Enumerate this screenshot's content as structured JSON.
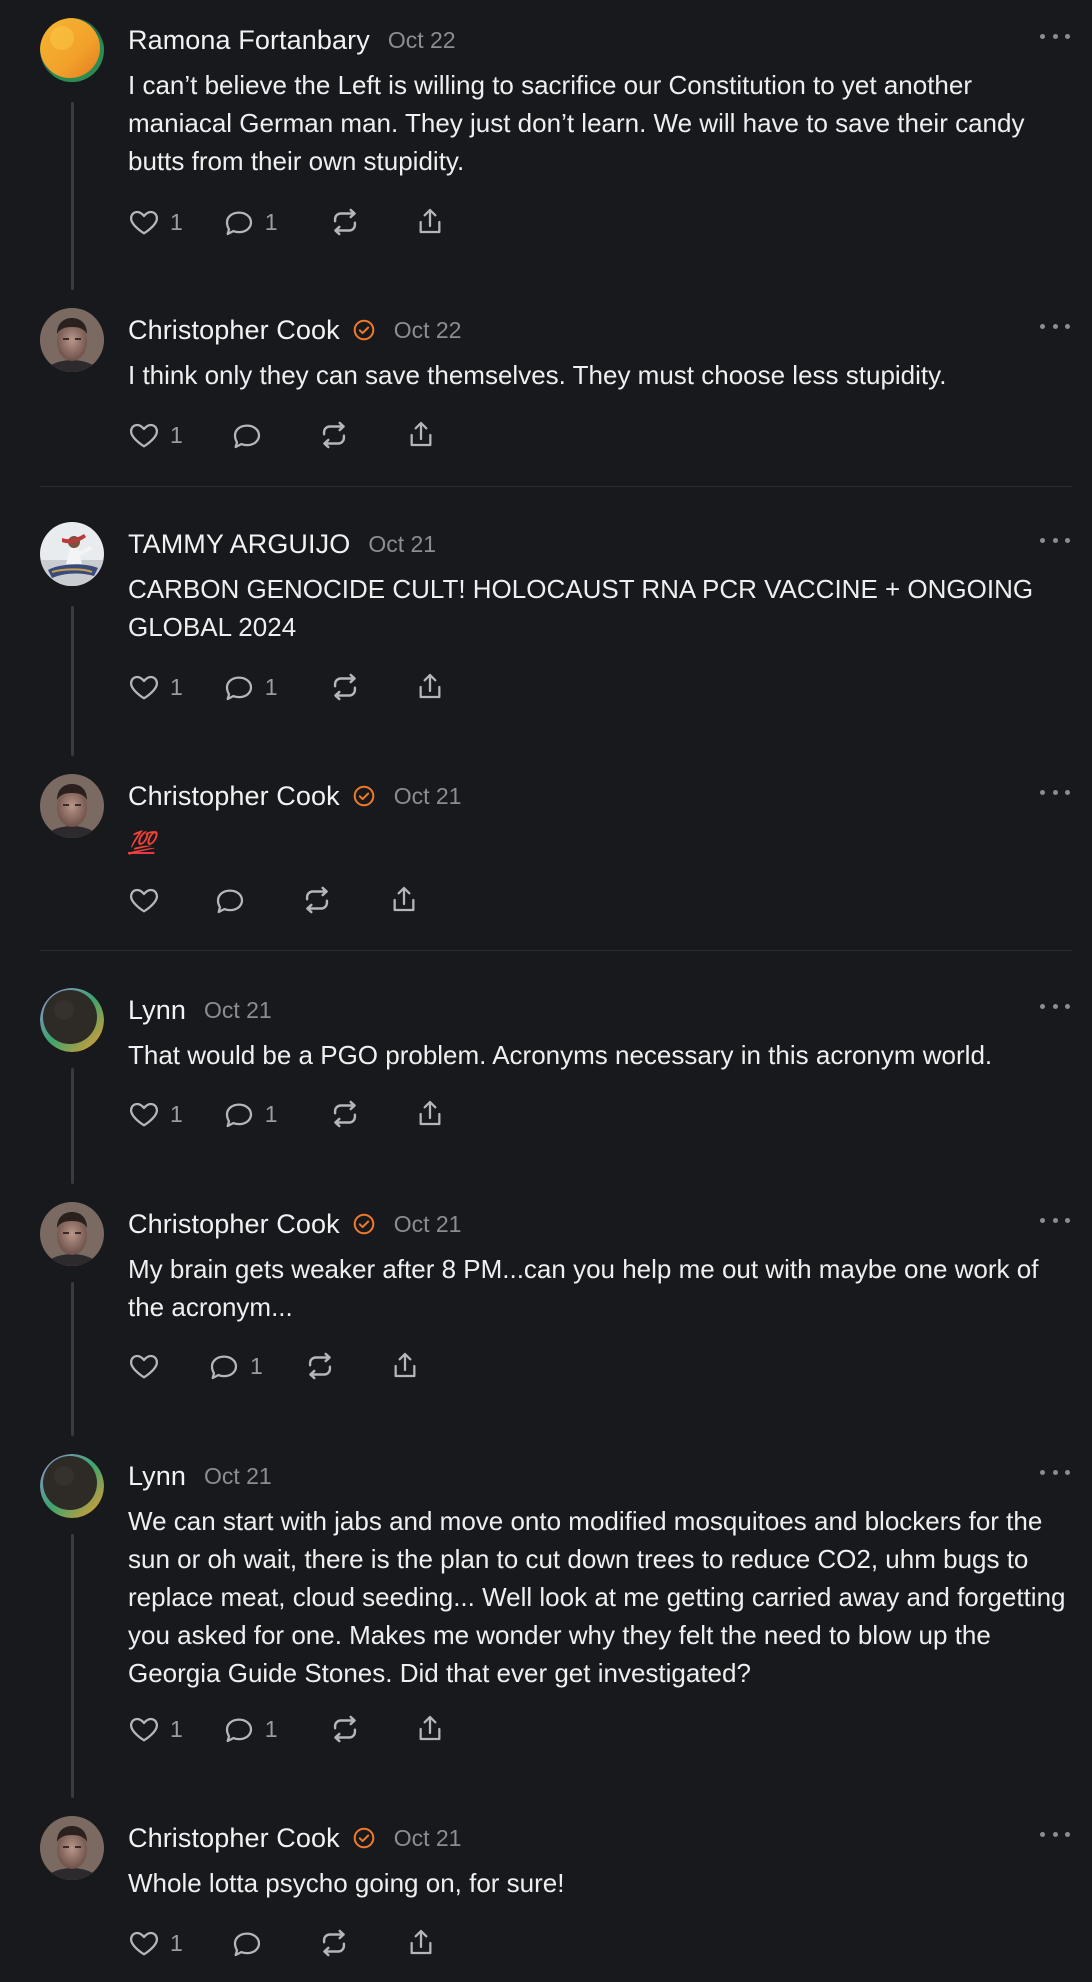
{
  "posts": [
    {
      "author": "Ramona Fortanbary",
      "date": "Oct 22",
      "verified": false,
      "avatar": "orange-green-gradient",
      "text": "I can’t believe the Left is willing to sacrifice our Constitution to yet another maniacal German man. They just don’t learn. We will have to save their candy butts from their own stupidity.",
      "likes": "1",
      "replies": "1"
    },
    {
      "author": "Christopher Cook",
      "date": "Oct 22",
      "verified": true,
      "avatar": "portrait-man",
      "text": "I think only they can save themselves. They must choose less stupidity.",
      "likes": "1",
      "replies": ""
    },
    {
      "author": "TAMMY ARGUIJO",
      "date": "Oct 21",
      "verified": false,
      "avatar": "illustration-figure",
      "text": "CARBON GENOCIDE CULT! HOLOCAUST RNA PCR VACCINE + ONGOING GLOBAL 2024",
      "likes": "1",
      "replies": "1"
    },
    {
      "author": "Christopher Cook",
      "date": "Oct 21",
      "verified": true,
      "avatar": "portrait-man",
      "text": "💯",
      "likes": "",
      "replies": ""
    },
    {
      "author": "Lynn",
      "date": "Oct 21",
      "verified": false,
      "avatar": "dark-orb-gradient",
      "text": "That would be a PGO problem. Acronyms necessary in this acronym world.",
      "likes": "1",
      "replies": "1"
    },
    {
      "author": "Christopher Cook",
      "date": "Oct 21",
      "verified": true,
      "avatar": "portrait-man",
      "text": "My brain gets weaker after 8 PM...can you help me out with maybe one work of the acronym...",
      "likes": "",
      "replies": "1"
    },
    {
      "author": "Lynn",
      "date": "Oct 21",
      "verified": false,
      "avatar": "dark-orb-gradient",
      "text": "We can start with jabs and move onto modified mosquitoes and blockers for the sun or oh wait, there is the plan to cut down trees to reduce CO2, uhm bugs to replace meat, cloud seeding... Well look at me getting carried away and forgetting you asked for one. Makes me wonder why they felt the need to blow up the Georgia Guide Stones. Did that ever get investigated?",
      "likes": "1",
      "replies": "1"
    },
    {
      "author": "Christopher Cook",
      "date": "Oct 21",
      "verified": true,
      "avatar": "portrait-man",
      "text": "Whole lotta psycho going on, for sure!",
      "likes": "1",
      "replies": ""
    }
  ],
  "icons": {
    "like": "heart-icon",
    "reply": "comment-bubble-icon",
    "repost": "repost-arrows-icon",
    "share": "share-upload-icon",
    "more": "more-ellipsis-icon",
    "verified": "verified-check-badge-icon"
  },
  "colors": {
    "background": "#18191c",
    "verified": "#f07a2a",
    "muted": "#8b8d92",
    "text": "#eeeff1"
  }
}
